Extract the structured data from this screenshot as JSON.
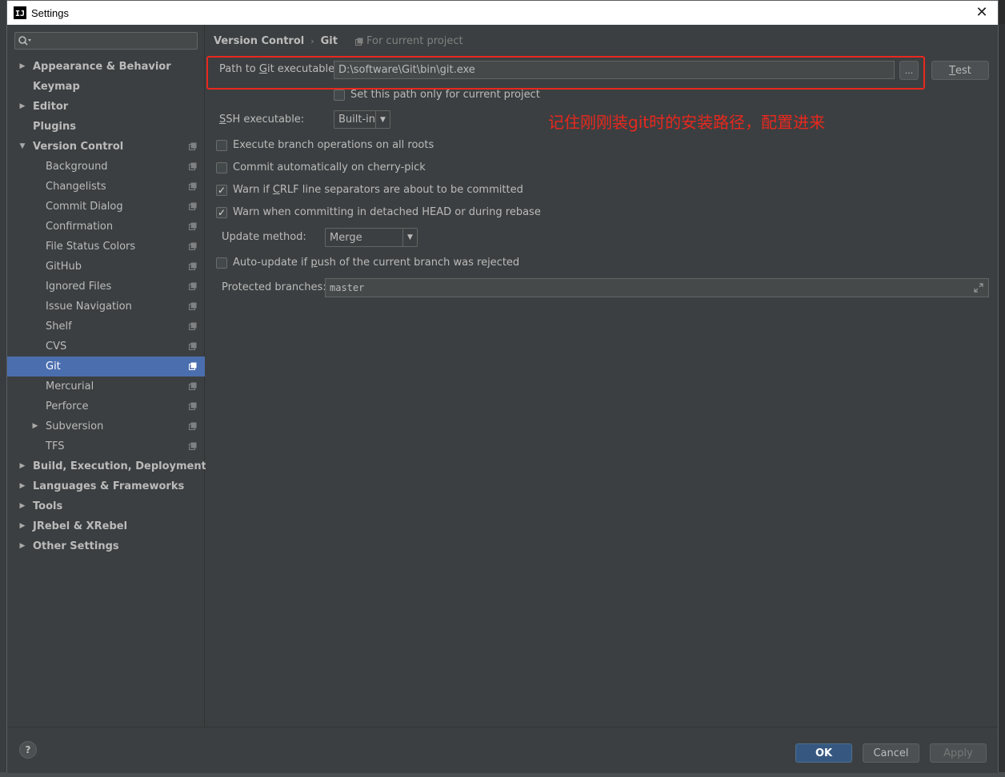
{
  "window": {
    "title": "Settings",
    "app_icon_text": "IJ",
    "close_glyph": "✕"
  },
  "sidebar": {
    "search_placeholder": "",
    "items": [
      {
        "label": "Appearance & Behavior",
        "level": 0,
        "arrow": "right"
      },
      {
        "label": "Keymap",
        "level": 0,
        "arrow": "none"
      },
      {
        "label": "Editor",
        "level": 0,
        "arrow": "right"
      },
      {
        "label": "Plugins",
        "level": 0,
        "arrow": "none"
      },
      {
        "label": "Version Control",
        "level": 0,
        "arrow": "down",
        "project": true
      },
      {
        "label": "Background",
        "level": 1,
        "project": true
      },
      {
        "label": "Changelists",
        "level": 1,
        "project": true
      },
      {
        "label": "Commit Dialog",
        "level": 1,
        "project": true
      },
      {
        "label": "Confirmation",
        "level": 1,
        "project": true
      },
      {
        "label": "File Status Colors",
        "level": 1,
        "project": true
      },
      {
        "label": "GitHub",
        "level": 1,
        "project": true
      },
      {
        "label": "Ignored Files",
        "level": 1,
        "project": true
      },
      {
        "label": "Issue Navigation",
        "level": 1,
        "project": true
      },
      {
        "label": "Shelf",
        "level": 1,
        "project": true
      },
      {
        "label": "CVS",
        "level": 1,
        "project": true
      },
      {
        "label": "Git",
        "level": 1,
        "project": true,
        "selected": true
      },
      {
        "label": "Mercurial",
        "level": 1,
        "project": true
      },
      {
        "label": "Perforce",
        "level": 1,
        "project": true
      },
      {
        "label": "Subversion",
        "level": 1,
        "project": true,
        "arrow": "right"
      },
      {
        "label": "TFS",
        "level": 1,
        "project": true
      },
      {
        "label": "Build, Execution, Deployment",
        "level": 0,
        "arrow": "right"
      },
      {
        "label": "Languages & Frameworks",
        "level": 0,
        "arrow": "right"
      },
      {
        "label": "Tools",
        "level": 0,
        "arrow": "right"
      },
      {
        "label": "JRebel & XRebel",
        "level": 0,
        "arrow": "right"
      },
      {
        "label": "Other Settings",
        "level": 0,
        "arrow": "right"
      }
    ]
  },
  "breadcrumb": {
    "parent": "Version Control",
    "separator": "›",
    "current": "Git",
    "scope": "For current project"
  },
  "git": {
    "path_label_pre": "Path to ",
    "path_label_u": "G",
    "path_label_post": "it executable:",
    "path_value": "D:\\software\\Git\\bin\\git.exe",
    "browse_label": "...",
    "test_label_u": "T",
    "test_label_post": "est",
    "current_project_only": {
      "label": "Set this path only for current project",
      "checked": false
    },
    "ssh_label_u": "S",
    "ssh_label_post": "SH executable:",
    "ssh_value": "Built-in",
    "annotation": "记住刚刚装git时的安装路径，配置进来",
    "checkboxes": [
      {
        "label": "Execute branch operations on all roots",
        "checked": false
      },
      {
        "label": "Commit automatically on cherry-pick",
        "checked": false
      },
      {
        "label_pre": "Warn if ",
        "label_u": "C",
        "label_post": "RLF line separators are about to be committed",
        "checked": true
      },
      {
        "label": "Warn when committing in detached HEAD or during rebase",
        "checked": true
      }
    ],
    "update_method_label": "Update method:",
    "update_method_value": "Merge",
    "auto_update": {
      "label_pre": "Auto-update if ",
      "label_u": "p",
      "label_post": "ush of the current branch was rejected",
      "checked": false
    },
    "protected_label": "Protected branches:",
    "protected_value": "master"
  },
  "footer": {
    "help": "?",
    "ok": "OK",
    "cancel": "Cancel",
    "apply": "Apply"
  },
  "colors": {
    "accent": "#4b6eaf",
    "annotation_red": "#e8281e",
    "ok_button": "#365880"
  }
}
